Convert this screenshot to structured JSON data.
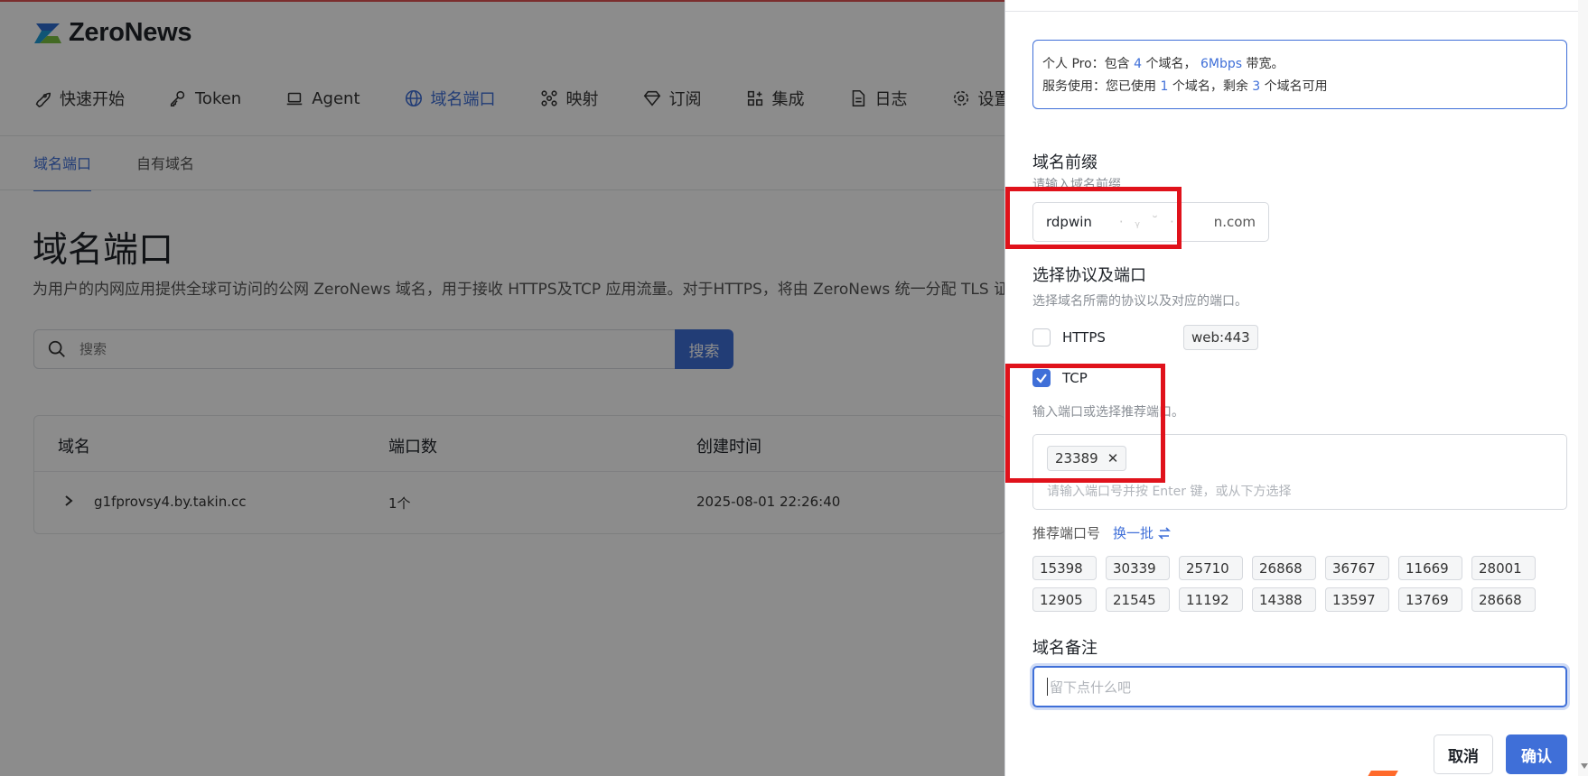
{
  "brand": {
    "name": "ZeroNews"
  },
  "nav": {
    "items": [
      {
        "label": "快速开始",
        "icon": "rocket-icon"
      },
      {
        "label": "Token",
        "icon": "key-icon"
      },
      {
        "label": "Agent",
        "icon": "laptop-icon"
      },
      {
        "label": "域名端口",
        "icon": "globe-icon",
        "active": true
      },
      {
        "label": "映射",
        "icon": "network-icon"
      },
      {
        "label": "订阅",
        "icon": "diamond-icon"
      },
      {
        "label": "集成",
        "icon": "apps-icon"
      },
      {
        "label": "日志",
        "icon": "file-icon"
      },
      {
        "label": "设置",
        "icon": "gear-icon"
      }
    ]
  },
  "subtabs": [
    "域名端口",
    "自有域名"
  ],
  "main": {
    "title": "域名端口",
    "description": "为用户的内网应用提供全球可访问的公网 ZeroNews 域名，用于接收 HTTPS及TCP 应用流量。对于HTTPS，将由 ZeroNews 统一分配 TLS 证",
    "search_placeholder": "搜索",
    "search_button": "搜索"
  },
  "table": {
    "headers": [
      "域名",
      "端口数",
      "创建时间"
    ],
    "rows": [
      {
        "domain": "g1fprovsy4.by.takin.cc",
        "ports": "1个",
        "created": "2025-08-01 22:26:40"
      }
    ]
  },
  "drawer": {
    "plan": {
      "line1_a": "个人 Pro：包含 ",
      "line1_domains": "4",
      "line1_b": " 个域名， ",
      "line1_bw": "6Mbps",
      "line1_c": " 带宽。",
      "line2_a": "服务使用：您已使用 ",
      "line2_used": "1",
      "line2_b": " 个域名，剩余 ",
      "line2_left": "3",
      "line2_c": " 个域名可用"
    },
    "prefix": {
      "label": "域名前缀",
      "hint": "请输入域名前缀",
      "value": "rdpwin",
      "blurred": "·  ᵧ ˘  ·ᵗ",
      "suffix": "n.com"
    },
    "protocol": {
      "label": "选择协议及端口",
      "hint": "选择域名所需的协议以及对应的端口。",
      "https_label": "HTTPS",
      "https_tag": "web:443",
      "https_checked": false,
      "tcp_label": "TCP",
      "tcp_checked": true,
      "tcp_hint": "输入端口或选择推荐端口。",
      "selected_port": "23389",
      "port_placeholder": "请输入端口号并按 Enter 键，或从下方选择"
    },
    "recommend": {
      "label": "推荐端口号",
      "refresh": "换一批",
      "ports": [
        "15398",
        "30339",
        "25710",
        "26868",
        "36767",
        "11669",
        "28001",
        "12905",
        "21545",
        "11192",
        "14388",
        "13597",
        "13769",
        "28668"
      ]
    },
    "note": {
      "label": "域名备注",
      "placeholder": "留下点什么吧"
    },
    "cancel": "取消",
    "confirm": "确认"
  },
  "colors": {
    "accent": "#3f6fd8",
    "highlight": "#e0121b"
  }
}
